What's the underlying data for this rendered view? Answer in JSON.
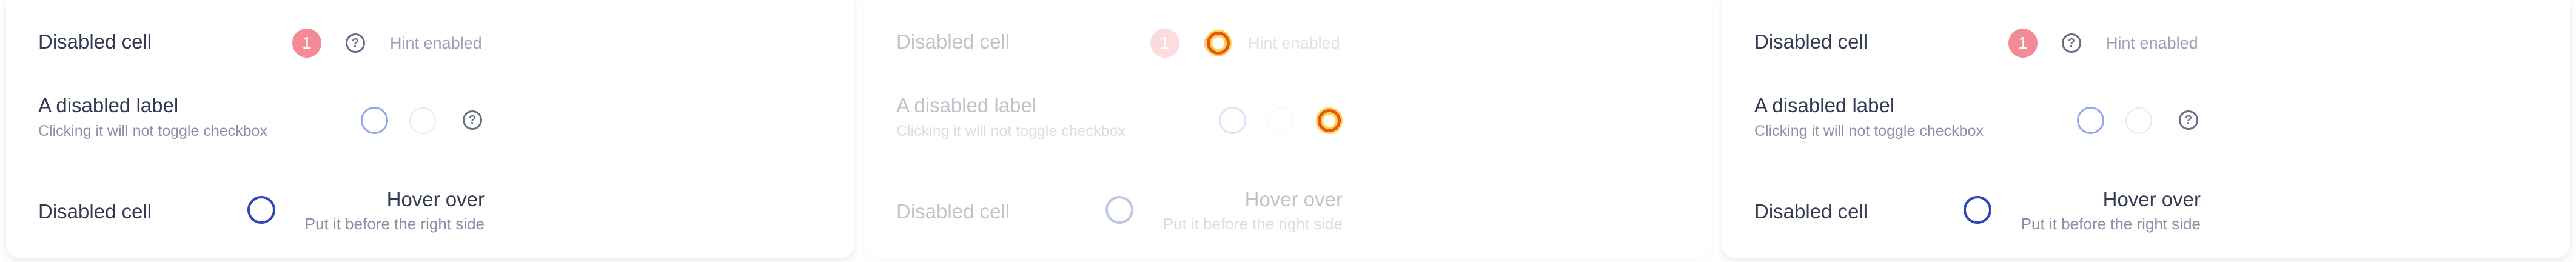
{
  "panels": [
    {
      "state": "enabled",
      "row1": {
        "label": "Disabled cell",
        "badge": "1",
        "hint": "Hint enabled",
        "help_icon": "question-circle-icon"
      },
      "row2": {
        "label": "A disabled label",
        "sublabel": "Clicking it will not toggle checkbox",
        "help_icon": "question-circle-icon"
      },
      "row3": {
        "label": "Disabled cell",
        "title": "Hover over",
        "subtitle": "Put it before the right side"
      }
    },
    {
      "state": "disabled",
      "row1": {
        "label": "Disabled cell",
        "badge": "1",
        "hint": "Hint enabled",
        "help_icon": "question-circle-icon"
      },
      "row2": {
        "label": "A disabled label",
        "sublabel": "Clicking it will not toggle checkbox",
        "help_icon": "question-circle-icon"
      },
      "row3": {
        "label": "Disabled cell",
        "title": "Hover over",
        "subtitle": "Put it before the right side"
      }
    },
    {
      "state": "enabled",
      "row1": {
        "label": "Disabled cell",
        "badge": "1",
        "hint": "Hint enabled",
        "help_icon": "question-circle-icon"
      },
      "row2": {
        "label": "A disabled label",
        "sublabel": "Clicking it will not toggle checkbox",
        "help_icon": "question-circle-icon"
      },
      "row3": {
        "label": "Disabled cell",
        "title": "Hover over",
        "subtitle": "Put it before the right side"
      }
    }
  ],
  "help_glyph": "?",
  "colors": {
    "badge": "#f28b95",
    "radio_selected_border": "#2f47b8",
    "radio_light_border": "#98a6e8",
    "focus_ring": "#e4541b"
  }
}
